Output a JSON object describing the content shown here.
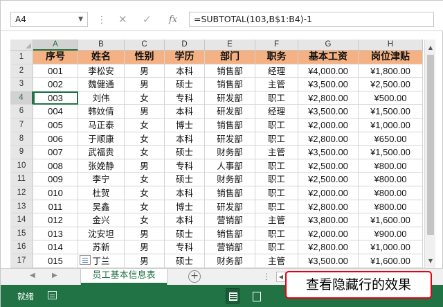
{
  "formula_bar": {
    "name_box": "A4",
    "name_box_dropdown": "▼",
    "separator": "⋮",
    "cancel_glyph": "✕",
    "enter_glyph": "✓",
    "fx_label": "fx",
    "formula": "=SUBTOTAL(103,B$1:B4)-1"
  },
  "columns": [
    {
      "letter": "A",
      "width": 65
    },
    {
      "letter": "B",
      "width": 67
    },
    {
      "letter": "C",
      "width": 58
    },
    {
      "letter": "D",
      "width": 58
    },
    {
      "letter": "E",
      "width": 73
    },
    {
      "letter": "F",
      "width": 62
    },
    {
      "letter": "G",
      "width": 87
    },
    {
      "letter": "H",
      "width": 93
    }
  ],
  "active": {
    "row": "4",
    "col": "A"
  },
  "rows": [
    {
      "num": "1",
      "cells": [
        "序号",
        "姓名",
        "性别",
        "学历",
        "部门",
        "职务",
        "基本工资",
        "岗位津贴"
      ]
    },
    {
      "num": "2",
      "cells": [
        "001",
        "李松安",
        "男",
        "本科",
        "销售部",
        "经理",
        "¥4,000.00",
        "¥1,800.00"
      ]
    },
    {
      "num": "3",
      "cells": [
        "002",
        "魏健通",
        "男",
        "硕士",
        "销售部",
        "主管",
        "¥3,500.00",
        "¥2,500.00"
      ]
    },
    {
      "num": "4",
      "cells": [
        "003",
        "刘伟",
        "女",
        "专科",
        "研发部",
        "职工",
        "¥2,800.00",
        "¥500.00"
      ]
    },
    {
      "num": "6",
      "cells": [
        "004",
        "韩妏倩",
        "男",
        "本科",
        "研发部",
        "经理",
        "¥3,500.00",
        "¥1,500.00"
      ]
    },
    {
      "num": "7",
      "cells": [
        "005",
        "马正泰",
        "女",
        "博士",
        "销售部",
        "职工",
        "¥2,000.00",
        "¥1,000.00"
      ]
    },
    {
      "num": "8",
      "cells": [
        "006",
        "于顺康",
        "女",
        "本科",
        "研发部",
        "职工",
        "¥2,800.00",
        "¥650.00"
      ]
    },
    {
      "num": "9",
      "cells": [
        "007",
        "武福贵",
        "女",
        "硕士",
        "财务部",
        "主管",
        "¥3,500.00",
        "¥1,500.00"
      ]
    },
    {
      "num": "10",
      "cells": [
        "008",
        "张娩静",
        "男",
        "专科",
        "人事部",
        "职工",
        "¥2,500.00",
        "¥800.00"
      ]
    },
    {
      "num": "11",
      "cells": [
        "009",
        "李宁",
        "女",
        "硕士",
        "财务部",
        "职工",
        "¥2,500.00",
        "¥800.00"
      ]
    },
    {
      "num": "12",
      "cells": [
        "010",
        "杜贺",
        "女",
        "本科",
        "销售部",
        "职工",
        "¥2,000.00",
        "¥800.00"
      ]
    },
    {
      "num": "13",
      "cells": [
        "011",
        "吴鑫",
        "女",
        "博士",
        "研发部",
        "职工",
        "¥2,800.00",
        "¥800.00"
      ]
    },
    {
      "num": "14",
      "cells": [
        "012",
        "金兴",
        "女",
        "本科",
        "营销部",
        "主管",
        "¥3,800.00",
        "¥1,600.00"
      ]
    },
    {
      "num": "15",
      "cells": [
        "013",
        "沈安坦",
        "男",
        "硕士",
        "销售部",
        "职工",
        "¥2,000.00",
        "¥900.00"
      ]
    },
    {
      "num": "16",
      "cells": [
        "014",
        "苏新",
        "男",
        "专科",
        "营销部",
        "职工",
        "¥2,800.00",
        "¥1,000.00"
      ]
    },
    {
      "num": "17",
      "cells": [
        "015",
        "丁兰",
        "男",
        "硕士",
        "财务部",
        "主管",
        "¥3,500.00",
        "¥1,600.00"
      ]
    }
  ],
  "scrollbar": {
    "up": "▲",
    "down": "▼"
  },
  "tabs": {
    "prev": "◀",
    "next": "▶",
    "active_sheet": "员工基本信息表",
    "add": "+",
    "more": "⋮",
    "hscroll_left": "◀"
  },
  "status": {
    "ready": "就绪"
  },
  "caption": "查看隐藏行的效果",
  "colors": {
    "header_fill": "#f4b183",
    "excel_green": "#217346",
    "callout_border": "#e60012"
  }
}
